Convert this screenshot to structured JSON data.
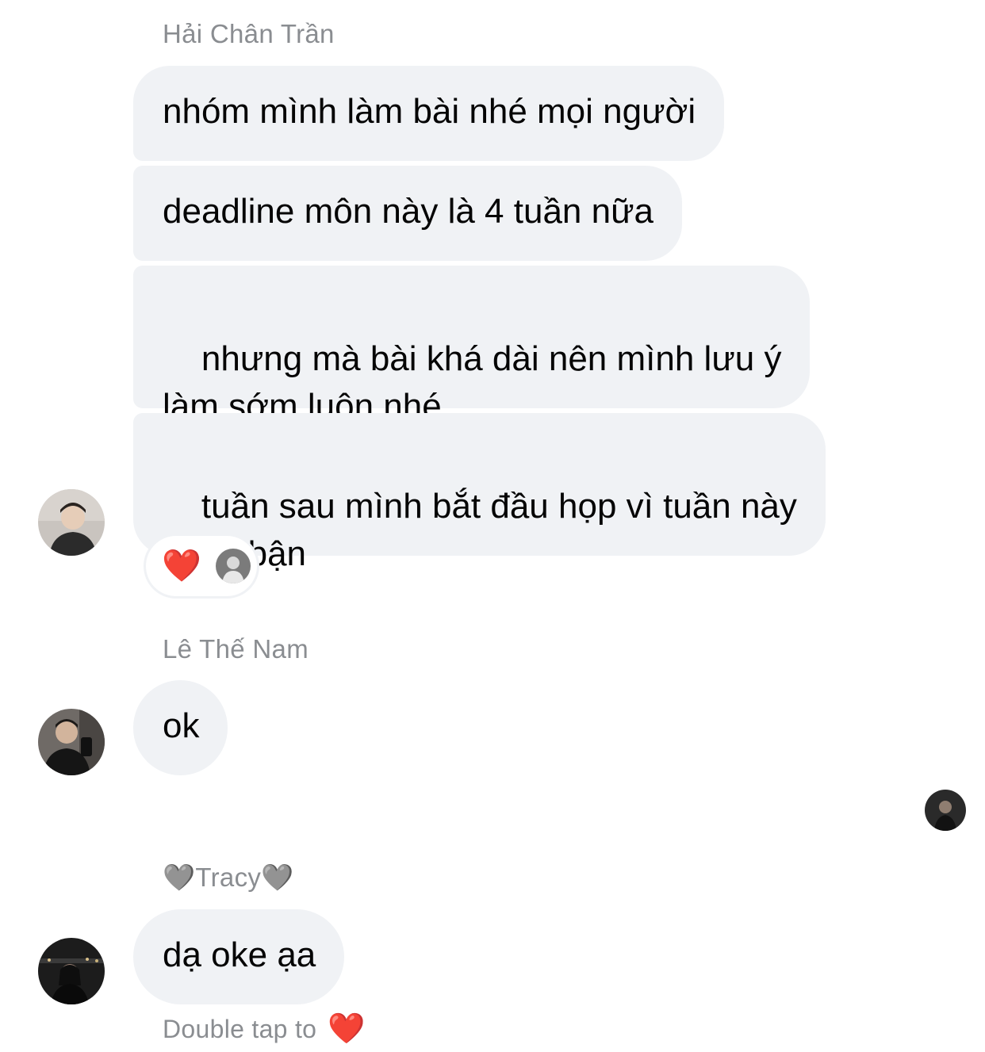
{
  "groups": [
    {
      "sender": "Hải Chân Trần",
      "messages": [
        "nhóm mình làm bài nhé mọi người",
        "deadline môn này là 4 tuần nữa",
        "nhưng mà bài khá dài nên mình lưu ý\nlàm sớm luôn nhé",
        "tuần sau mình bắt đầu họp vì tuần này\nMinh bận"
      ],
      "reaction": "❤️"
    },
    {
      "sender": "Lê Thế Nam",
      "messages": [
        "ok"
      ]
    },
    {
      "sender": "🩶Tracy🩶",
      "messages": [
        "dạ oke ạa"
      ]
    }
  ],
  "hint": {
    "text": "Double tap to",
    "emoji": "❤️"
  },
  "colors": {
    "bubble": "#f0f2f5",
    "sender_text": "#8a8d91",
    "heart": "#e8161e"
  }
}
